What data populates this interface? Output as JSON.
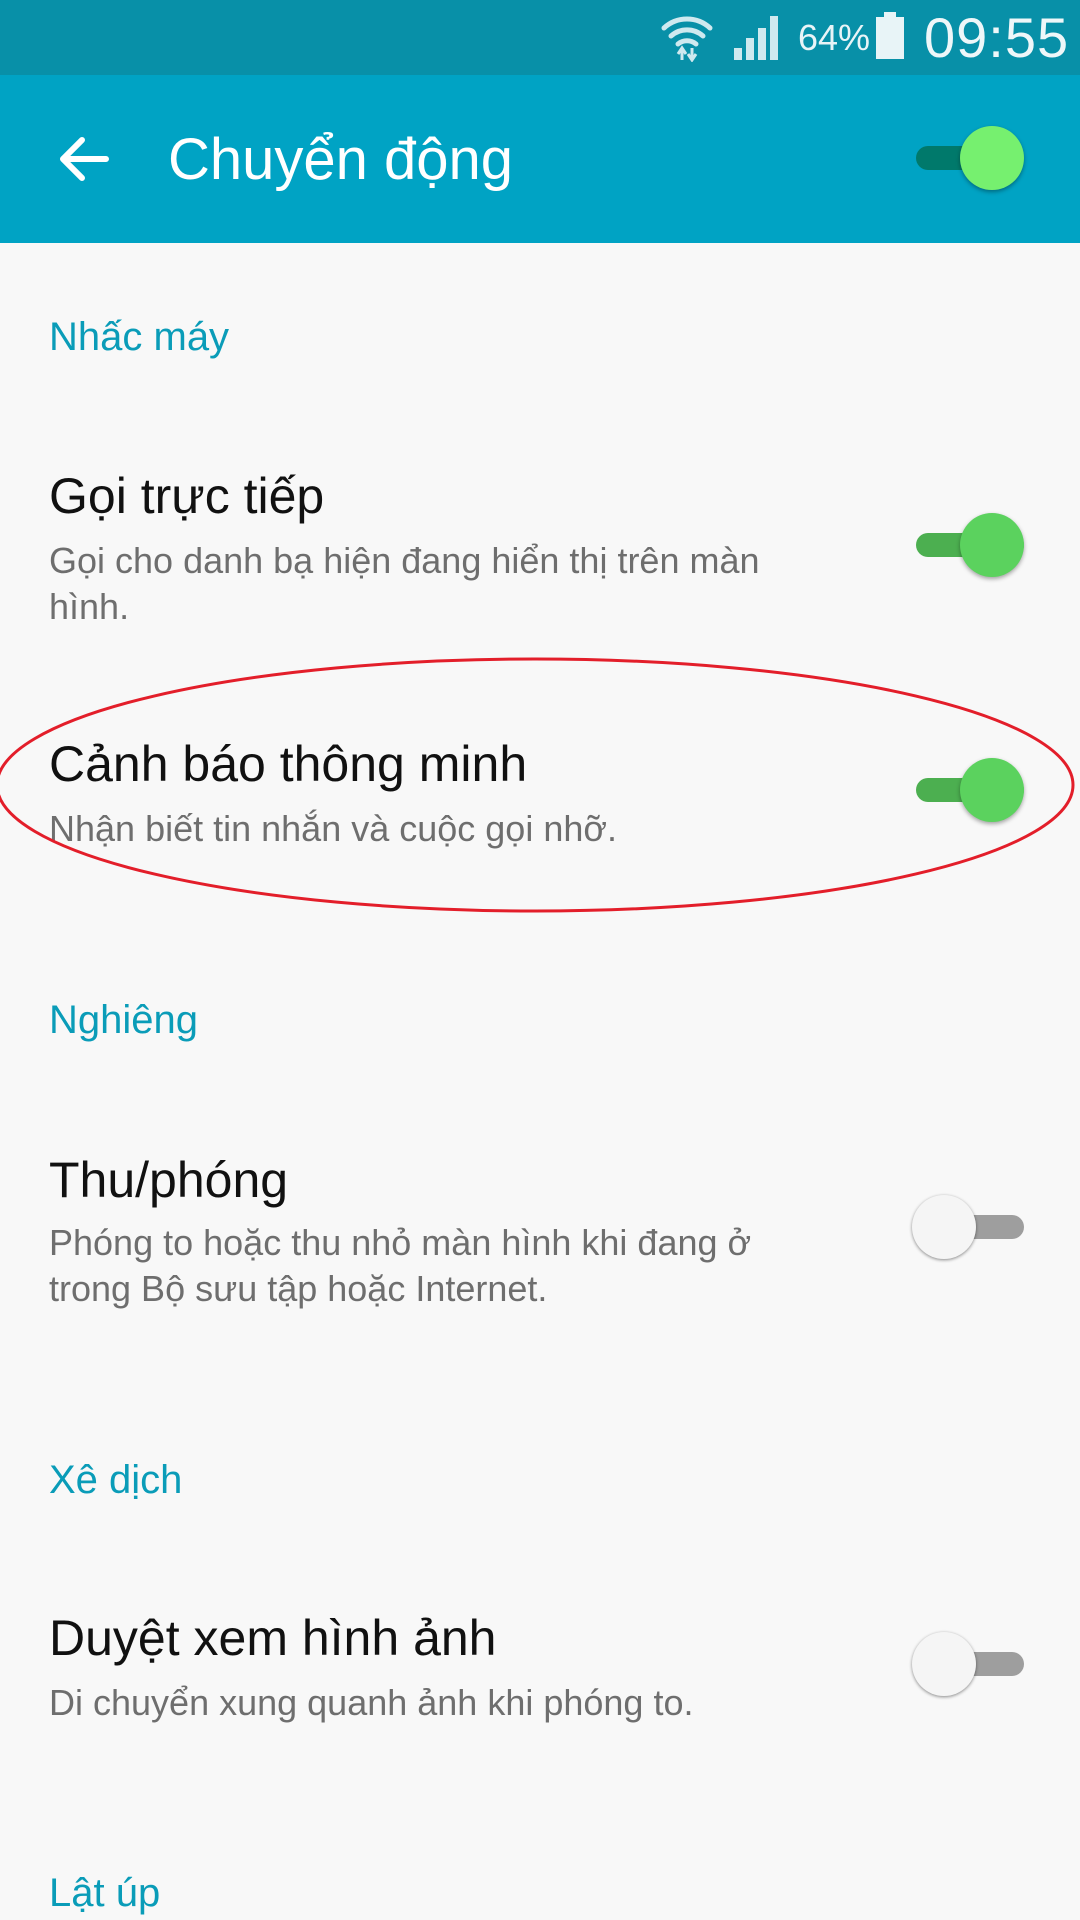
{
  "status_bar": {
    "battery_percent": "64%",
    "time": "09:55",
    "icons": [
      "wifi-icon",
      "signal-icon",
      "battery-icon"
    ]
  },
  "header": {
    "title": "Chuyển động",
    "back_icon": "arrow-left-icon",
    "master_toggle_on": true
  },
  "sections": [
    {
      "title": "Nhấc máy",
      "items": [
        {
          "title": "Gọi trực tiếp",
          "summary": "Gọi cho danh bạ hiện đang hiển thị trên màn hình.",
          "enabled": true
        },
        {
          "title": "Cảnh báo thông minh",
          "summary": "Nhận biết tin nhắn và cuộc gọi nhỡ.",
          "enabled": true,
          "highlighted": true
        }
      ]
    },
    {
      "title": "Nghiêng",
      "items": [
        {
          "title": "Thu/phóng",
          "summary": "Phóng to hoặc thu nhỏ màn hình khi đang ở trong Bộ sưu tập hoặc Internet.",
          "enabled": false
        }
      ]
    },
    {
      "title": "Xê dịch",
      "items": [
        {
          "title": "Duyệt xem hình ảnh",
          "summary": "Di chuyển xung quanh ảnh khi phóng to.",
          "enabled": false
        }
      ]
    },
    {
      "title": "Lật úp",
      "items": []
    }
  ],
  "colors": {
    "status_bar": "#0890a8",
    "action_bar": "#00a3c4",
    "section_header": "#0a9cb8",
    "toggle_on": "#5bd25e",
    "highlight": "#e31e2a"
  }
}
